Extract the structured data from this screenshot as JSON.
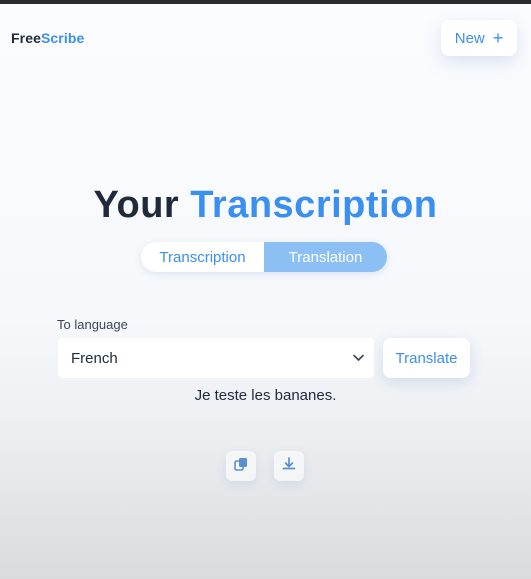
{
  "header": {
    "logo_primary": "Free",
    "logo_accent": "Scribe",
    "new_button_label": "New",
    "new_button_icon": "plus-icon"
  },
  "main": {
    "title_primary": "Your",
    "title_accent": "Transcription",
    "tabs": [
      {
        "label": "Transcription",
        "active": false
      },
      {
        "label": "Translation",
        "active": true
      }
    ],
    "language_label": "To language",
    "language_selected": "French",
    "translate_button_label": "Translate",
    "translated_text": "Je teste les bananes.",
    "actions": [
      {
        "icon": "copy-icon"
      },
      {
        "icon": "download-icon"
      }
    ]
  },
  "colors": {
    "accent": "#3b8ff0",
    "active_tab": "#8cc0f5",
    "text_dark": "#1f2a3a"
  }
}
